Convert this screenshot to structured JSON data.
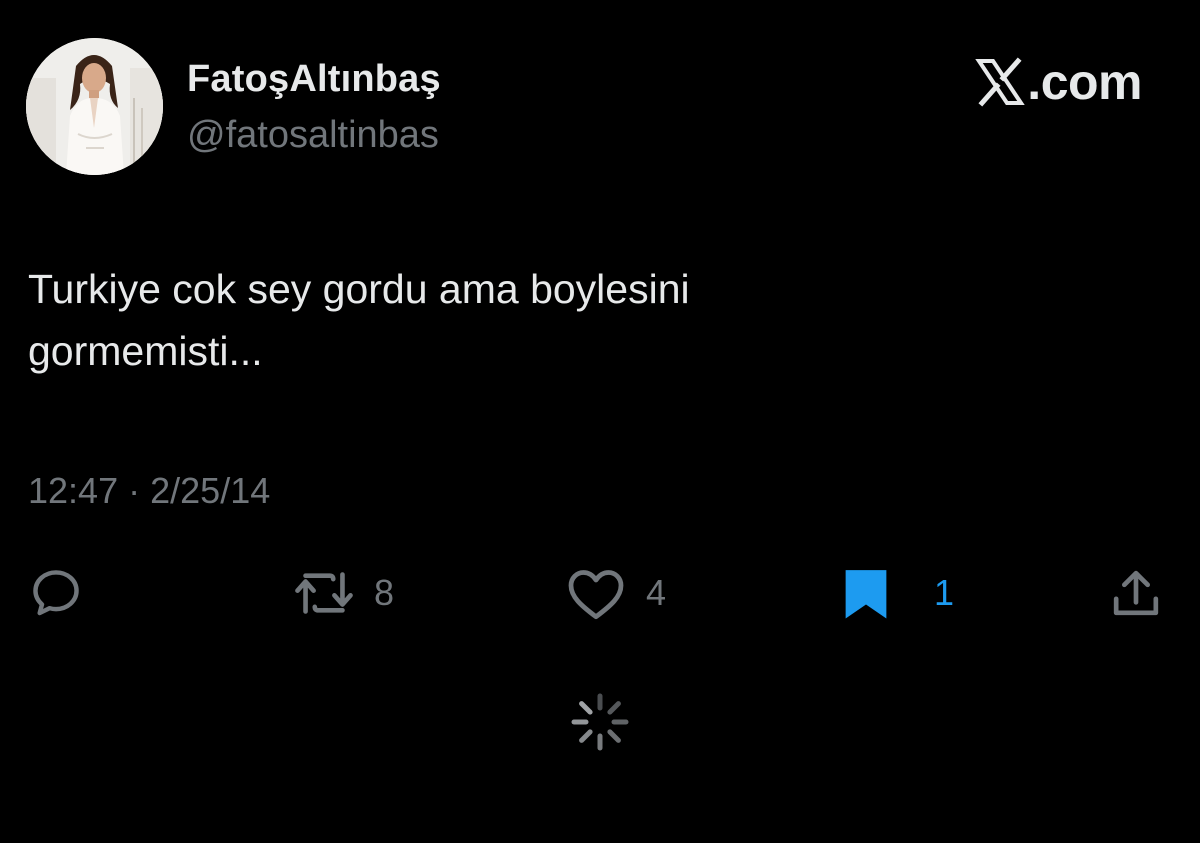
{
  "brand": {
    "text": ".com",
    "icon": "x-logo-icon"
  },
  "author": {
    "display_name": "FatoşAltınbaş",
    "handle": "@fatosaltinbas",
    "avatar": "profile-photo"
  },
  "tweet": {
    "lines": [
      "Turkiye cok sey gordu ama boylesini",
      "gormemisti..."
    ],
    "time": "12:47",
    "separator": "·",
    "date": "2/25/14"
  },
  "actions": {
    "reply": {
      "icon": "reply-icon",
      "count": ""
    },
    "retweet": {
      "icon": "retweet-icon",
      "count": "8"
    },
    "like": {
      "icon": "heart-icon",
      "count": "4"
    },
    "bookmark": {
      "icon": "bookmark-filled-icon",
      "count": "1",
      "active": true
    },
    "share": {
      "icon": "share-icon",
      "count": ""
    }
  },
  "colors": {
    "background": "#000000",
    "primary_text": "#e7e9ea",
    "secondary_text": "#71767b",
    "accent": "#1d9bf0"
  },
  "loading": {
    "icon": "loading-spinner-icon"
  }
}
